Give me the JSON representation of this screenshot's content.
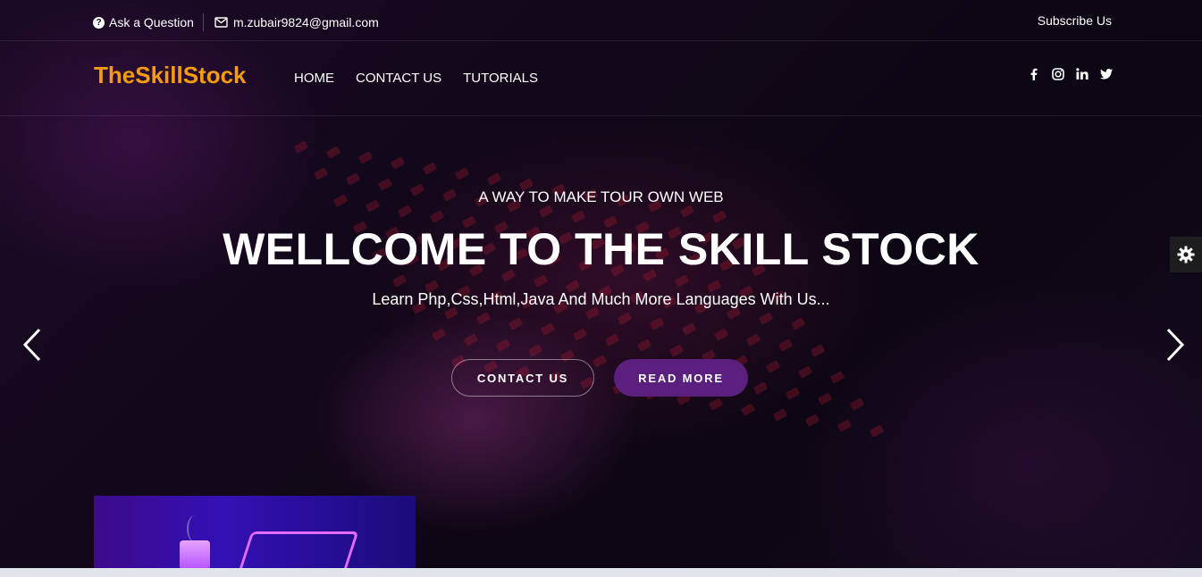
{
  "topbar": {
    "ask_label": "Ask a Question",
    "email": "m.zubair9824@gmail.com",
    "subscribe_label": "Subscribe Us"
  },
  "nav": {
    "brand": "TheSkillStock",
    "items": [
      {
        "label": "HOME"
      },
      {
        "label": "CONTACT US"
      },
      {
        "label": "TUTORIALS"
      }
    ],
    "social_icons": [
      "facebook-icon",
      "instagram-icon",
      "linkedin-icon",
      "twitter-icon"
    ]
  },
  "hero": {
    "subtitle": "A WAY TO MAKE TOUR OWN WEB",
    "title": "WELLCOME TO THE SKILL STOCK",
    "tagline": "Learn Php,Css,Html,Java And Much More Languages With Us...",
    "contact_button": "CONTACT US",
    "read_more_button": "READ MORE"
  },
  "colors": {
    "brand": "#f39c12",
    "button_primary": "#5b1f7d",
    "background": "#110718"
  }
}
